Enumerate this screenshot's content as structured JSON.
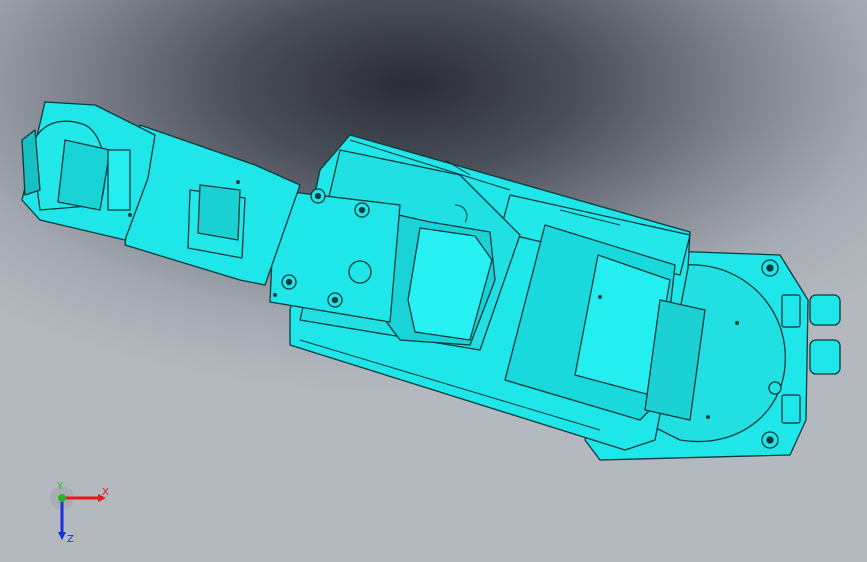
{
  "viewport": {
    "name": "3d-model-viewport"
  },
  "colors": {
    "model_fill": "#1fe6e8",
    "model_edge": "#0b3b3e",
    "model_shade": "#14b9bd",
    "axis_x": "#e21b1b",
    "axis_y": "#2ab42a",
    "axis_z": "#1b2fe2"
  },
  "triad": {
    "x_label": "X",
    "y_label": "Y",
    "z_label": "Z"
  }
}
